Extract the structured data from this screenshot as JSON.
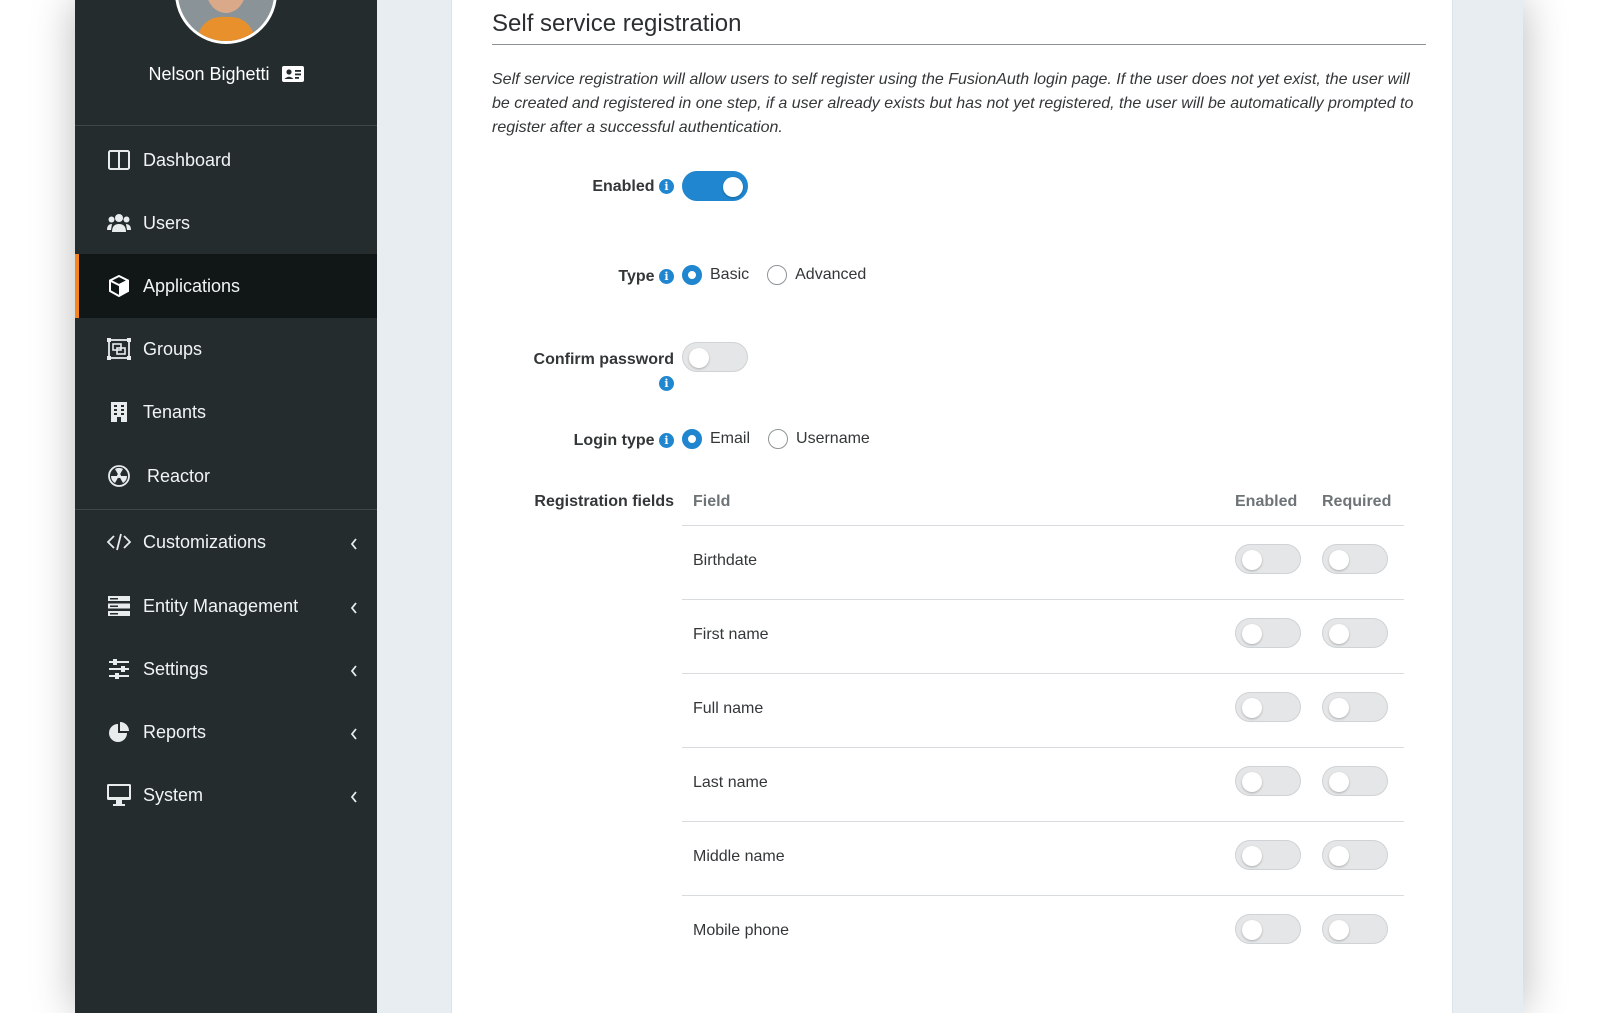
{
  "user": {
    "name": "Nelson Bighetti"
  },
  "nav": {
    "items": [
      {
        "label": "Dashboard",
        "icon": "columns-icon",
        "active": false,
        "expandable": false
      },
      {
        "label": "Users",
        "icon": "users-icon",
        "active": false,
        "expandable": false
      },
      {
        "label": "Applications",
        "icon": "cube-icon",
        "active": true,
        "expandable": false
      },
      {
        "label": "Groups",
        "icon": "object-group-icon",
        "active": false,
        "expandable": false
      },
      {
        "label": "Tenants",
        "icon": "building-icon",
        "active": false,
        "expandable": false
      },
      {
        "label": "Reactor",
        "icon": "radiation-icon",
        "active": false,
        "expandable": false
      },
      {
        "label": "Customizations",
        "icon": "code-icon",
        "active": false,
        "expandable": true
      },
      {
        "label": "Entity Management",
        "icon": "server-icon",
        "active": false,
        "expandable": true
      },
      {
        "label": "Settings",
        "icon": "sliders-icon",
        "active": false,
        "expandable": true
      },
      {
        "label": "Reports",
        "icon": "pie-chart-icon",
        "active": false,
        "expandable": true
      },
      {
        "label": "System",
        "icon": "desktop-icon",
        "active": false,
        "expandable": true
      }
    ]
  },
  "section": {
    "title": "Self service registration",
    "description": "Self service registration will allow users to self register using the FusionAuth login page. If the user does not yet exist, the user will be created and registered in one step, if a user already exists but has not yet registered, the user will be automatically prompted to register after a successful authentication."
  },
  "form": {
    "enabled": {
      "label": "Enabled",
      "value": true
    },
    "type": {
      "label": "Type",
      "options": [
        "Basic",
        "Advanced"
      ],
      "selected": "Basic"
    },
    "confirm_password": {
      "label": "Confirm password",
      "value": false
    },
    "login_type": {
      "label": "Login type",
      "options": [
        "Email",
        "Username"
      ],
      "selected": "Email"
    },
    "registration_fields": {
      "label": "Registration fields",
      "headers": {
        "field": "Field",
        "enabled": "Enabled",
        "required": "Required"
      },
      "rows": [
        {
          "field": "Birthdate",
          "enabled": false,
          "required": false
        },
        {
          "field": "First name",
          "enabled": false,
          "required": false
        },
        {
          "field": "Full name",
          "enabled": false,
          "required": false
        },
        {
          "field": "Last name",
          "enabled": false,
          "required": false
        },
        {
          "field": "Middle name",
          "enabled": false,
          "required": false
        },
        {
          "field": "Mobile phone",
          "enabled": false,
          "required": false
        }
      ]
    }
  },
  "colors": {
    "accent": "#1f86cf",
    "active_bar": "#f58320",
    "sidebar": "#242c2e"
  }
}
